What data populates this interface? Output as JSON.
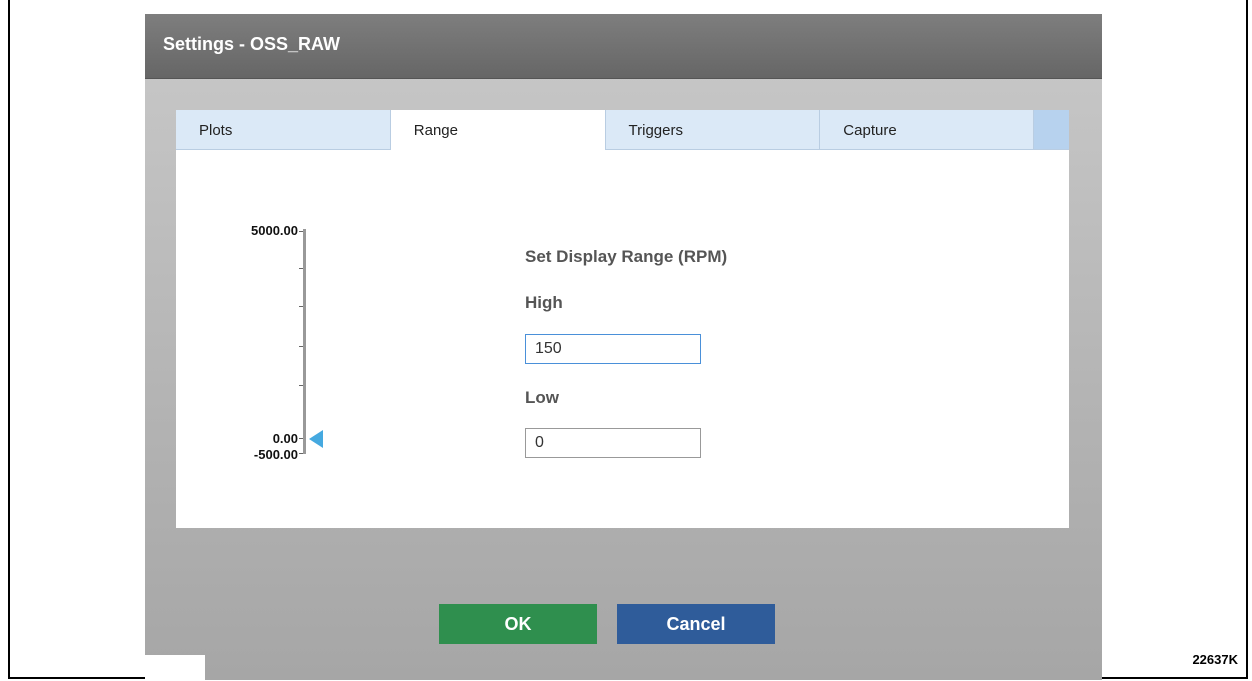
{
  "dialog": {
    "title": "Settings - OSS_RAW"
  },
  "tabs": [
    {
      "label": "Plots",
      "active": false
    },
    {
      "label": "Range",
      "active": true
    },
    {
      "label": "Triggers",
      "active": false
    },
    {
      "label": "Capture",
      "active": false
    }
  ],
  "axis": {
    "max_label": "5000.00",
    "zero_label": "0.00",
    "min_label": "-500.00",
    "marker_value": 0
  },
  "range": {
    "title": "Set Display Range (RPM)",
    "high_label": "High",
    "high_value": "150",
    "low_label": "Low",
    "low_value": "0"
  },
  "buttons": {
    "ok": "OK",
    "cancel": "Cancel"
  },
  "figure_id": "22637K",
  "colors": {
    "titlebar": "#6e6e6e",
    "tab_inactive": "#dbe9f7",
    "ok_button": "#2f8f4e",
    "cancel_button": "#2f5c9a",
    "marker": "#45a9e0"
  }
}
